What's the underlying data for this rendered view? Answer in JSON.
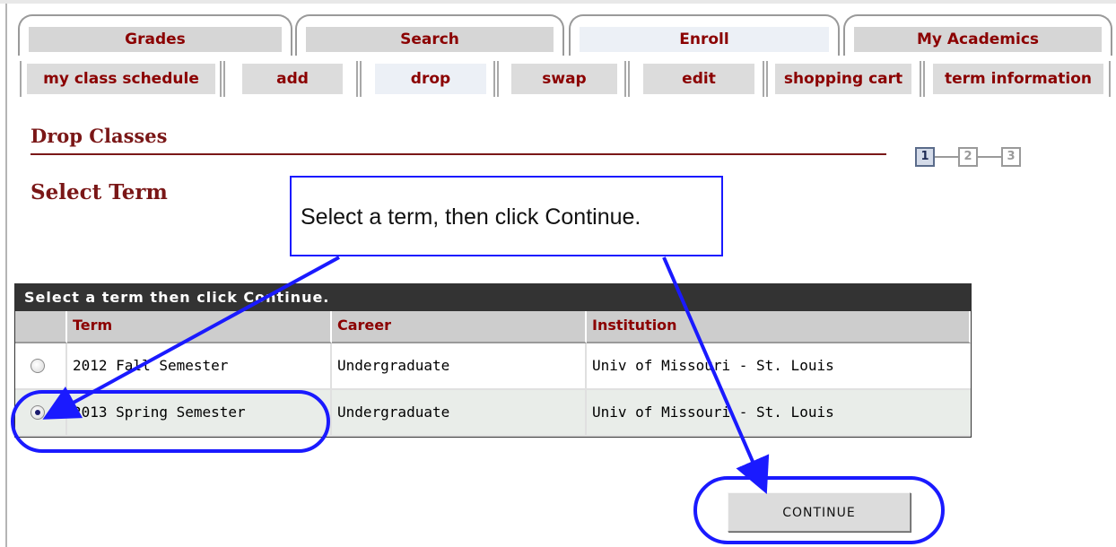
{
  "main_tabs": [
    {
      "label": "Grades",
      "active": false
    },
    {
      "label": "Search",
      "active": false
    },
    {
      "label": "Enroll",
      "active": true
    },
    {
      "label": "My Academics",
      "active": false
    }
  ],
  "sub_tabs": [
    {
      "label": "my class schedule",
      "active": false
    },
    {
      "label": "add",
      "active": false
    },
    {
      "label": "drop",
      "active": true
    },
    {
      "label": "swap",
      "active": false
    },
    {
      "label": "edit",
      "active": false
    },
    {
      "label": "shopping cart",
      "active": false
    },
    {
      "label": "term information",
      "active": false
    }
  ],
  "page": {
    "title": "Drop Classes",
    "section_title": "Select Term"
  },
  "steps": {
    "current": "1",
    "labels": [
      "1",
      "2",
      "3"
    ]
  },
  "callout": {
    "text": "Select a term, then click Continue."
  },
  "grid": {
    "caption": "Select a term then click Continue.",
    "headers": [
      "Term",
      "Career",
      "Institution"
    ],
    "rows": [
      {
        "term": "2012 Fall Semester",
        "career": "Undergraduate",
        "institution": "Univ of Missouri - St. Louis",
        "selected": false
      },
      {
        "term": "2013 Spring Semester",
        "career": "Undergraduate",
        "institution": "Univ of Missouri - St. Louis",
        "selected": true
      }
    ]
  },
  "continue_button": {
    "label": "CONTINUE"
  },
  "colors": {
    "tab_text": "#8b0000",
    "title": "#7a1717",
    "annotation": "#1a1aff",
    "grid_caption_bg": "#333333"
  }
}
